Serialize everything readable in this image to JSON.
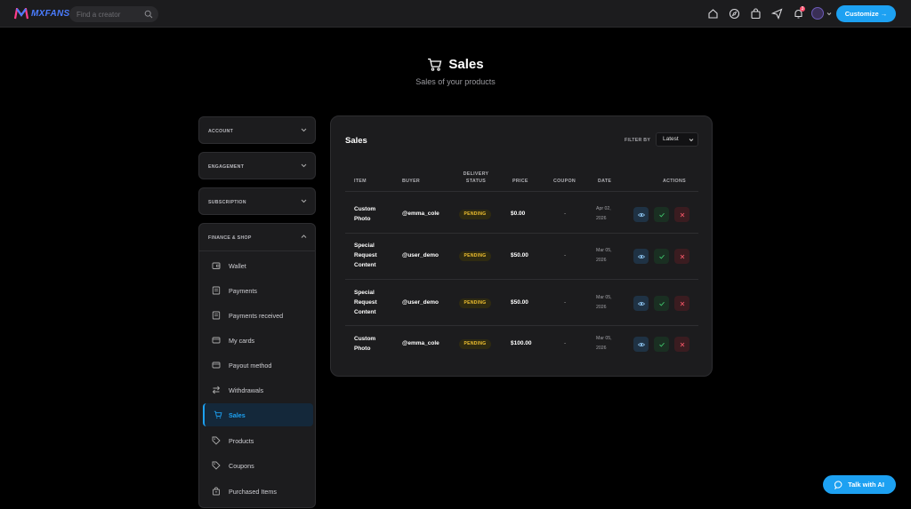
{
  "app": {
    "brand": "MXFANS"
  },
  "search": {
    "placeholder": "Find a creator"
  },
  "topbar": {
    "notification_count": "3",
    "customize_label": "Customize →"
  },
  "page": {
    "title": "Sales",
    "subtitle": "Sales of your products"
  },
  "sidebar": {
    "sections": [
      {
        "label": "ACCOUNT"
      },
      {
        "label": "ENGAGEMENT"
      },
      {
        "label": "SUBSCRIPTION"
      }
    ],
    "finance": {
      "label": "FINANCE & SHOP",
      "items": [
        {
          "label": "Wallet",
          "icon": "wallet-icon"
        },
        {
          "label": "Payments",
          "icon": "receipt-icon"
        },
        {
          "label": "Payments received",
          "icon": "receipt-icon"
        },
        {
          "label": "My cards",
          "icon": "card-icon"
        },
        {
          "label": "Payout method",
          "icon": "card-icon"
        },
        {
          "label": "Withdrawals",
          "icon": "transfer-icon"
        },
        {
          "label": "Sales",
          "icon": "cart-icon",
          "active": true
        },
        {
          "label": "Products",
          "icon": "tag-icon"
        },
        {
          "label": "Coupons",
          "icon": "tag-icon"
        },
        {
          "label": "Purchased Items",
          "icon": "bag-icon"
        }
      ]
    }
  },
  "sales": {
    "title": "Sales",
    "filter_label": "FILTER BY",
    "filter_value": "Latest",
    "columns": {
      "item": "ITEM",
      "buyer": "BUYER",
      "delivery_1": "DELIVERY",
      "delivery_2": "STATUS",
      "price": "PRICE",
      "coupon": "COUPON",
      "date": "DATE",
      "actions": "ACTIONS"
    },
    "rows": [
      {
        "item_1": "Custom",
        "item_2": "Photo",
        "item_3": "",
        "buyer": "@emma_cole",
        "status": "PENDING",
        "price": "$0.00",
        "coupon": "-",
        "date_1": "Apr 02,",
        "date_2": "2026"
      },
      {
        "item_1": "Special",
        "item_2": "Request",
        "item_3": "Content",
        "buyer": "@user_demo",
        "status": "PENDING",
        "price": "$50.00",
        "coupon": "-",
        "date_1": "Mar 05,",
        "date_2": "2026"
      },
      {
        "item_1": "Special",
        "item_2": "Request",
        "item_3": "Content",
        "buyer": "@user_demo",
        "status": "PENDING",
        "price": "$50.00",
        "coupon": "-",
        "date_1": "Mar 05,",
        "date_2": "2026"
      },
      {
        "item_1": "Custom",
        "item_2": "Photo",
        "item_3": "",
        "buyer": "@emma_cole",
        "status": "PENDING",
        "price": "$100.00",
        "coupon": "-",
        "date_1": "Mar 05,",
        "date_2": "2026"
      }
    ]
  },
  "ai_button": {
    "label": "Talk with AI"
  },
  "colors": {
    "accent": "#1da1f2",
    "pending": "#f2c230",
    "background": "#000000",
    "panel": "#1c1c1e"
  }
}
